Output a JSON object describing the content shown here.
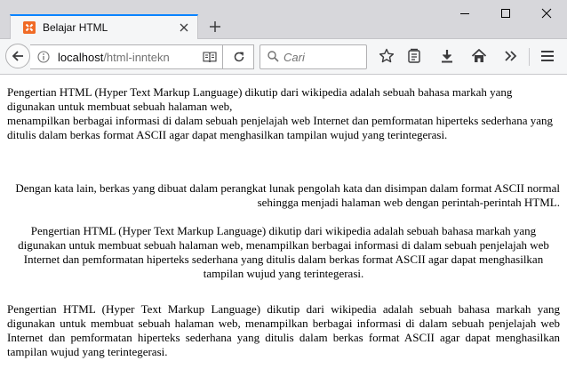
{
  "tab": {
    "favicon_glyph": "✕",
    "title": "Belajar HTML"
  },
  "window_controls": {
    "minimize": "minimize",
    "maximize": "maximize",
    "close": "close"
  },
  "navbar": {
    "url_host": "localhost",
    "url_path": "/html-inntekn",
    "search_placeholder": "Cari"
  },
  "page": {
    "p1_line1": "Pengertian HTML (Hyper Text Markup Language) dikutip dari wikipedia adalah sebuah bahasa markah yang digunakan untuk membuat sebuah halaman web,",
    "p1_line2": "menampilkan berbagai informasi di dalam sebuah penjelajah web Internet dan pemformatan hiperteks sederhana yang ditulis dalam berkas format ASCII agar dapat menghasilkan tampilan wujud yang terintegerasi.",
    "p2": "Dengan kata lain, berkas yang dibuat dalam perangkat lunak pengolah kata dan disimpan dalam format ASCII normal sehingga menjadi halaman web dengan perintah-perintah HTML.",
    "p3": "Pengertian HTML (Hyper Text Markup Language) dikutip dari wikipedia adalah sebuah bahasa markah yang digunakan untuk membuat sebuah halaman web, menampilkan berbagai informasi di dalam sebuah penjelajah web Internet dan pemformatan hiperteks sederhana yang ditulis dalam berkas format ASCII agar dapat menghasilkan tampilan wujud yang terintegerasi.",
    "p4": "Pengertian HTML (Hyper Text Markup Language) dikutip dari wikipedia adalah sebuah bahasa markah yang digunakan untuk membuat sebuah halaman web, menampilkan berbagai informasi di dalam sebuah penjelajah web Internet dan pemformatan hiperteks sederhana yang ditulis dalam berkas format ASCII agar dapat menghasilkan tampilan wujud yang terintegerasi."
  },
  "colors": {
    "accent": "#0a84ff",
    "favicon": "#f06b26",
    "titlebar": "#d7d7db",
    "toolbar": "#f5f6f7"
  }
}
